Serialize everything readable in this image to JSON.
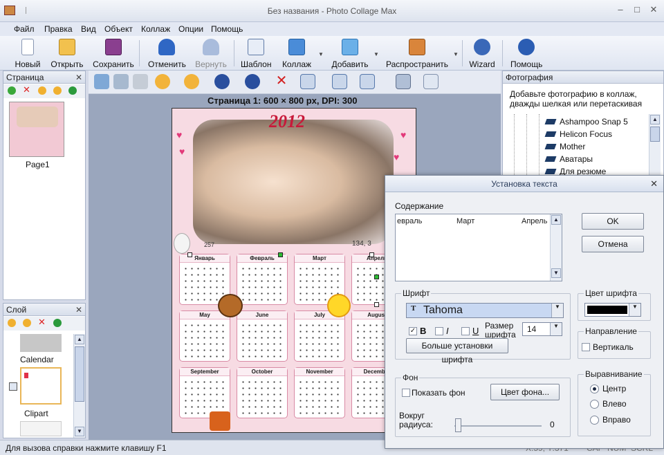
{
  "window": {
    "title": "Без названия - Photo Collage Max",
    "minimize": "–",
    "maximize": "□",
    "close": "✕"
  },
  "menu": [
    "Файл",
    "Правка",
    "Вид",
    "Объект",
    "Коллаж",
    "Опции",
    "Помощь"
  ],
  "toolbar": {
    "new": "Новый",
    "open": "Открыть",
    "save": "Сохранить",
    "undo": "Отменить",
    "redo": "Вернуть",
    "template": "Шаблон",
    "collage": "Коллаж",
    "add": "Добавить",
    "share": "Распространить",
    "wizard": "Wizard",
    "help": "Помощь",
    "dropdown": "▼"
  },
  "page_panel": {
    "title": "Страница",
    "close": "✕",
    "thumb_label": "Page1"
  },
  "layer_panel": {
    "title": "Слой",
    "close": "✕",
    "items": [
      "Calendar",
      "Clipart"
    ]
  },
  "canvas": {
    "caption": "Страница 1: 600 × 800 px, DPI: 300",
    "year": "2012",
    "months_row1": [
      "Январь",
      "Февраль",
      "Март",
      "Апрель"
    ],
    "months_row2": [
      "May",
      "June",
      "July",
      "August"
    ],
    "months_row3": [
      "September",
      "October",
      "November",
      "December"
    ],
    "photo_label_left": "257",
    "photo_label_right": "134, 3"
  },
  "photo_panel": {
    "title": "Фотография",
    "hint": "Добавьте фотографию в коллаж, дважды шелкая или перетаскивая",
    "folders": [
      "Ashampoo Snap 5",
      "Helicon Focus",
      "Mother",
      "Аватары",
      "Для резюме"
    ]
  },
  "statusbar": {
    "help": "Для вызова справки нажмите клавишу F1",
    "coords": "X:59, Y:371",
    "cap": "CAP",
    "num": "NUM",
    "scrl": "SCRL"
  },
  "dialog": {
    "title": "Установка текста",
    "close": "✕",
    "content_label": "Содержание",
    "content_text": [
      "евраль",
      "Март",
      "Апрель"
    ],
    "ok": "OK",
    "cancel": "Отмена",
    "font_group": "Шрифт",
    "font_name": "Tahoma",
    "bold": "B",
    "italic": "I",
    "underline": "U",
    "size_label_1": "Размер",
    "size_label_2": "шрифта",
    "size_value": "14",
    "more_font": "Больше установки шрифта",
    "font_color_group": "Цвет шрифта",
    "direction_group": "Направление",
    "vertical": "Вертикаль",
    "background_group": "Фон",
    "show_bg": "Показать фон",
    "bg_color": "Цвет фона...",
    "radius_label_1": "Вокруг",
    "radius_label_2": "радиуса:",
    "radius_value": "0",
    "align_group": "Выравнивание",
    "align_center": "Центр",
    "align_left": "Влево",
    "align_right": "Вправо",
    "checkmark": "✓",
    "font_color": "#000000"
  }
}
